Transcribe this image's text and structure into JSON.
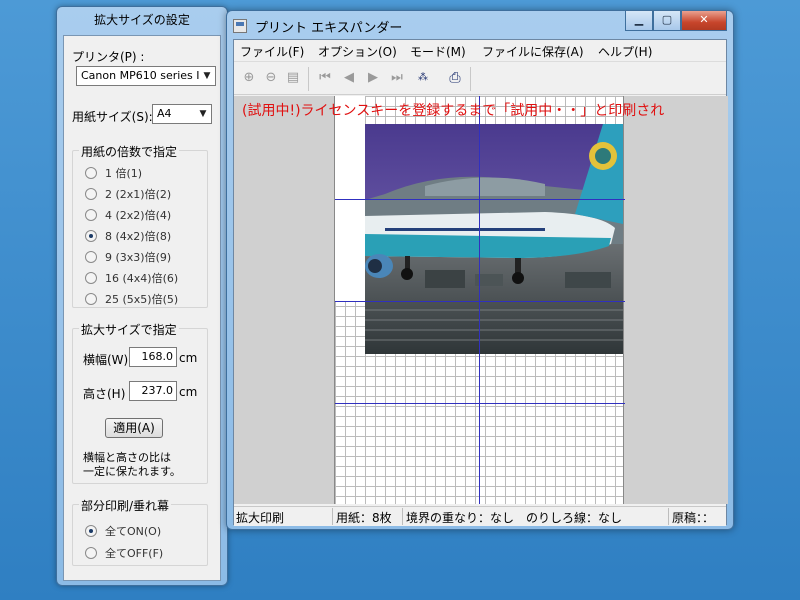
{
  "panel": {
    "title": "拡大サイズの設定",
    "printer_label": "プリンタ(P) :",
    "printer_value": "Canon MP610 series I",
    "paper_label": "用紙サイズ(S):",
    "paper_value": "A4",
    "multiple_group": "用紙の倍数で指定",
    "multiples": [
      {
        "label": "1 倍(1)",
        "selected": false
      },
      {
        "label": "2 (2x1)倍(2)",
        "selected": false
      },
      {
        "label": "4 (2x2)倍(4)",
        "selected": false
      },
      {
        "label": "8 (4x2)倍(8)",
        "selected": true
      },
      {
        "label": "9 (3x3)倍(9)",
        "selected": false
      },
      {
        "label": "16 (4x4)倍(6)",
        "selected": false
      },
      {
        "label": "25 (5x5)倍(5)",
        "selected": false
      }
    ],
    "size_group": "拡大サイズで指定",
    "width_label": "横幅(W)",
    "width_value": "168.0",
    "width_unit": "cm",
    "height_label": "高さ(H)",
    "height_value": "237.0",
    "height_unit": "cm",
    "apply_button": "適用(A)",
    "ratio_note_1": "横幅と高さの比は",
    "ratio_note_2": "一定に保たれます。",
    "partial_group": "部分印刷/垂れ幕",
    "all_on": "全てON(O)",
    "all_off": "全てOFF(F)"
  },
  "window": {
    "title": "プリント エキスパンダー",
    "menu": [
      "ファイル(F)",
      "オプション(O)",
      "モード(M)",
      "ファイルに保存(A)",
      "ヘルプ(H)"
    ],
    "toolbar_icons": [
      "zoom-in-icon",
      "zoom-out-icon",
      "page-icon",
      "first-page-icon",
      "prev-page-icon",
      "next-page-icon",
      "last-page-icon",
      "settings-icon",
      "print-icon"
    ],
    "trial_notice": "(試用中!)ライセンスキーを登録するまで「試用中・・」と印刷され",
    "status": {
      "mode": "拡大印刷",
      "paper_count": "用紙：8枚",
      "overlap": "境界の重なり：なし",
      "margin_line": "のりしろ線：なし",
      "original": "原稿：："
    }
  },
  "colors": {
    "trial_text": "#e01010",
    "cut_line": "#3030c0",
    "title_bar": "#a9cdee"
  }
}
